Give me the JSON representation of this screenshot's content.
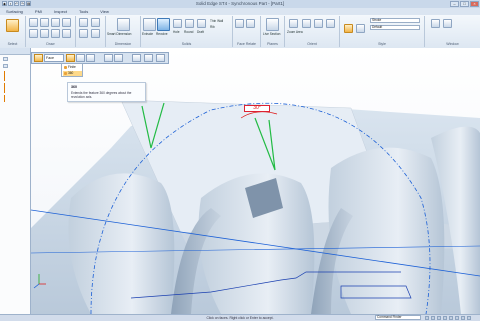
{
  "window": {
    "title": "Solid Edge ST4 - Synchronous Part - [Part1]"
  },
  "qat_icons": [
    "app-menu-icon",
    "save-icon",
    "undo-icon",
    "redo-icon",
    "print-icon"
  ],
  "tabs": [
    "Surfacing",
    "PMI",
    "Inspect",
    "Tools",
    "View"
  ],
  "ribbon": {
    "groups": [
      "Select",
      "Draw",
      "Solids",
      "Dimension",
      "Face Relate",
      "Planes",
      "Orient",
      "Style",
      "Window"
    ],
    "buttons": {
      "smart_dimension": "Smart Dimension",
      "extrude": "Extrude",
      "revolve": "Revolve",
      "hole": "Hole",
      "round": "Round",
      "draft": "Draft",
      "thin_wall": "Thin Wall",
      "rib": "Rib",
      "live_section": "Live Section",
      "zoom_area": "Zoom Area"
    },
    "style": {
      "primary": "Stroke",
      "secondary": "Default"
    }
  },
  "commandbar": {
    "face_select": "Face"
  },
  "dropdown": {
    "options": [
      "Finite",
      "360"
    ],
    "selected": "360"
  },
  "tooltip": {
    "title": "360",
    "body": "Extends the feature 360 degrees about the revolution axis."
  },
  "dimension": {
    "value": "30°"
  },
  "status": {
    "message": "Click on faces. Right click or Enter to accept.",
    "command_finder": "Command Finder"
  },
  "colors": {
    "accent": "#f2b447",
    "construction_blue": "#1a5fd6",
    "highlight_green": "#22bb44",
    "dimension_red": "#d11"
  }
}
